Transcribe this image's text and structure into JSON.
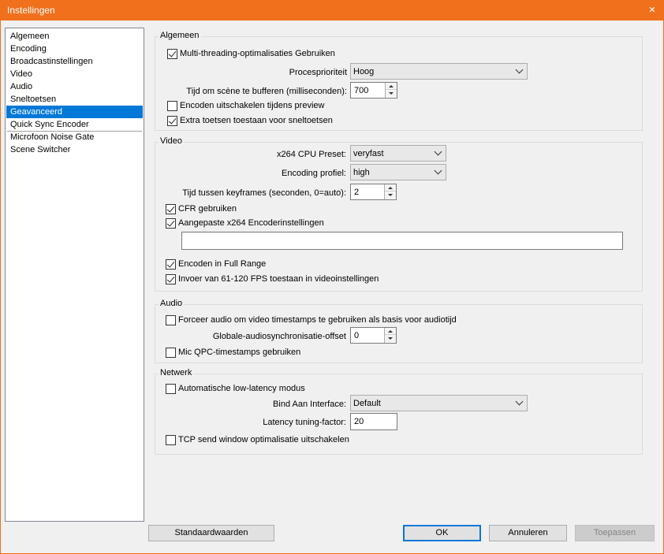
{
  "window": {
    "title": "Instellingen",
    "close_glyph": "✕"
  },
  "sidebar": {
    "items": [
      {
        "label": "Algemeen"
      },
      {
        "label": "Encoding"
      },
      {
        "label": "Broadcastinstellingen"
      },
      {
        "label": "Video"
      },
      {
        "label": "Audio"
      },
      {
        "label": "Sneltoetsen"
      },
      {
        "label": "Geavanceerd",
        "selected": true
      },
      {
        "label": "Quick Sync Encoder"
      },
      {
        "label": "Microfoon Noise Gate"
      },
      {
        "label": "Scene Switcher"
      }
    ]
  },
  "general": {
    "title": "Algemeen",
    "multithreading": {
      "label": "Multi-threading-optimalisaties Gebruiken",
      "checked": true
    },
    "priority": {
      "label": "Procesprioriteit",
      "value": "Hoog"
    },
    "buffer": {
      "label": "Tijd om scène te bufferen (milliseconden):",
      "value": "700"
    },
    "disable_preview": {
      "label": "Encoden uitschakelen tijdens preview",
      "checked": false
    },
    "extra_keys": {
      "label": "Extra toetsen toestaan voor sneltoetsen",
      "checked": true
    }
  },
  "video": {
    "title": "Video",
    "preset": {
      "label": "x264 CPU Preset:",
      "value": "veryfast"
    },
    "profile": {
      "label": "Encoding profiel:",
      "value": "high"
    },
    "keyframes": {
      "label": "Tijd tussen keyframes (seconden, 0=auto):",
      "value": "2"
    },
    "cfr": {
      "label": "CFR gebruiken",
      "checked": true
    },
    "custom_x264": {
      "label": "Aangepaste x264 Encoderinstellingen",
      "checked": true,
      "value": ""
    },
    "full_range": {
      "label": "Encoden in Full Range",
      "checked": true
    },
    "fps_input": {
      "label": "Invoer van 61-120 FPS toestaan in videoinstellingen",
      "checked": true
    }
  },
  "audio": {
    "title": "Audio",
    "force_timestamps": {
      "label": "Forceer audio om video timestamps te gebruiken als basis voor audiotijd",
      "checked": false
    },
    "sync_offset": {
      "label": "Globale-audiosynchronisatie-offset",
      "value": "0"
    },
    "mic_qpc": {
      "label": "Mic QPC-timestamps gebruiken",
      "checked": false
    }
  },
  "network": {
    "title": "Netwerk",
    "low_latency": {
      "label": "Automatische low-latency modus",
      "checked": false
    },
    "bind": {
      "label": "Bind Aan Interface:",
      "value": "Default"
    },
    "latency_factor": {
      "label": "Latency tuning-factor:",
      "value": "20"
    },
    "tcp_window": {
      "label": "TCP send window optimalisatie uitschakelen",
      "checked": false
    }
  },
  "buttons": {
    "defaults": "Standaardwaarden",
    "ok": "OK",
    "cancel": "Annuleren",
    "apply": "Toepassen"
  },
  "colors": {
    "accent": "#f0701c",
    "selection": "#0078d7"
  }
}
